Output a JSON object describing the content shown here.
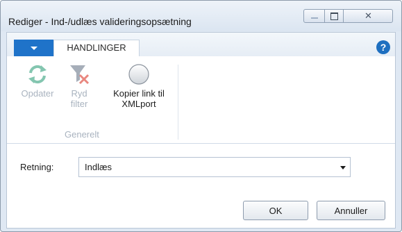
{
  "window": {
    "title": "Rediger - Ind-/udlæs valideringsopsætning",
    "controls": [
      "minimize-icon",
      "maximize-icon",
      "close-icon"
    ]
  },
  "ribbon": {
    "menu_icon": "chevron-down-icon",
    "tab_label": "HANDLINGER",
    "help_label": "?",
    "actions": [
      {
        "label": "Opdater",
        "icon": "refresh-icon",
        "enabled": false
      },
      {
        "label": "Ryd filter",
        "icon": "clear-filter-icon",
        "enabled": false
      },
      {
        "label": "Kopier link til XMLport",
        "icon": "circle-icon",
        "enabled": true
      }
    ],
    "group_label": "Generelt"
  },
  "form": {
    "direction_label": "Retning:",
    "direction_value": "Indlæs"
  },
  "buttons": {
    "ok_label": "OK",
    "cancel_label": "Annuller"
  },
  "colors": {
    "accent": "#1f73c9",
    "disabled_text": "#a9b3bf",
    "refresh_icon": "#84c6b0",
    "clear_filter_x": "#e9877f"
  }
}
